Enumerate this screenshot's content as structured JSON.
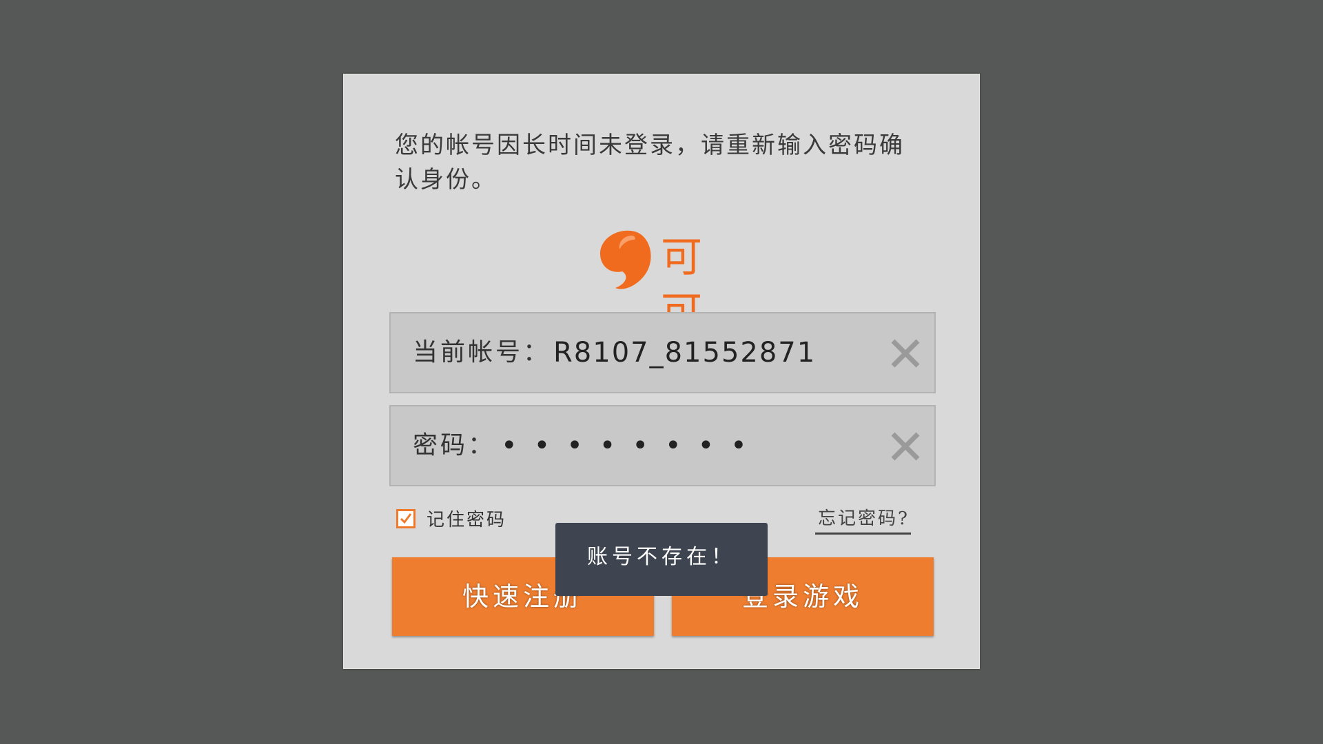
{
  "dialog": {
    "notice": "您的帐号因长时间未登录，请重新输入密码确认身份。",
    "logo_text": "可可",
    "account": {
      "label": "当前帐号：",
      "value": "R8107_81552871",
      "clear_icon": "close-icon"
    },
    "password": {
      "label": "密码：",
      "masked_value": "••••••••",
      "clear_icon": "close-icon"
    },
    "remember": {
      "label": "记住密码",
      "checked": true
    },
    "forgot_label": "忘记密码?",
    "register_button": "快速注册",
    "login_button": "登录游戏"
  },
  "toast": {
    "message": "账号不存在！"
  },
  "colors": {
    "accent": "#ef7d2f",
    "background": "#555856",
    "dialog": "#d9d9d9",
    "toast": "#3e4550"
  }
}
